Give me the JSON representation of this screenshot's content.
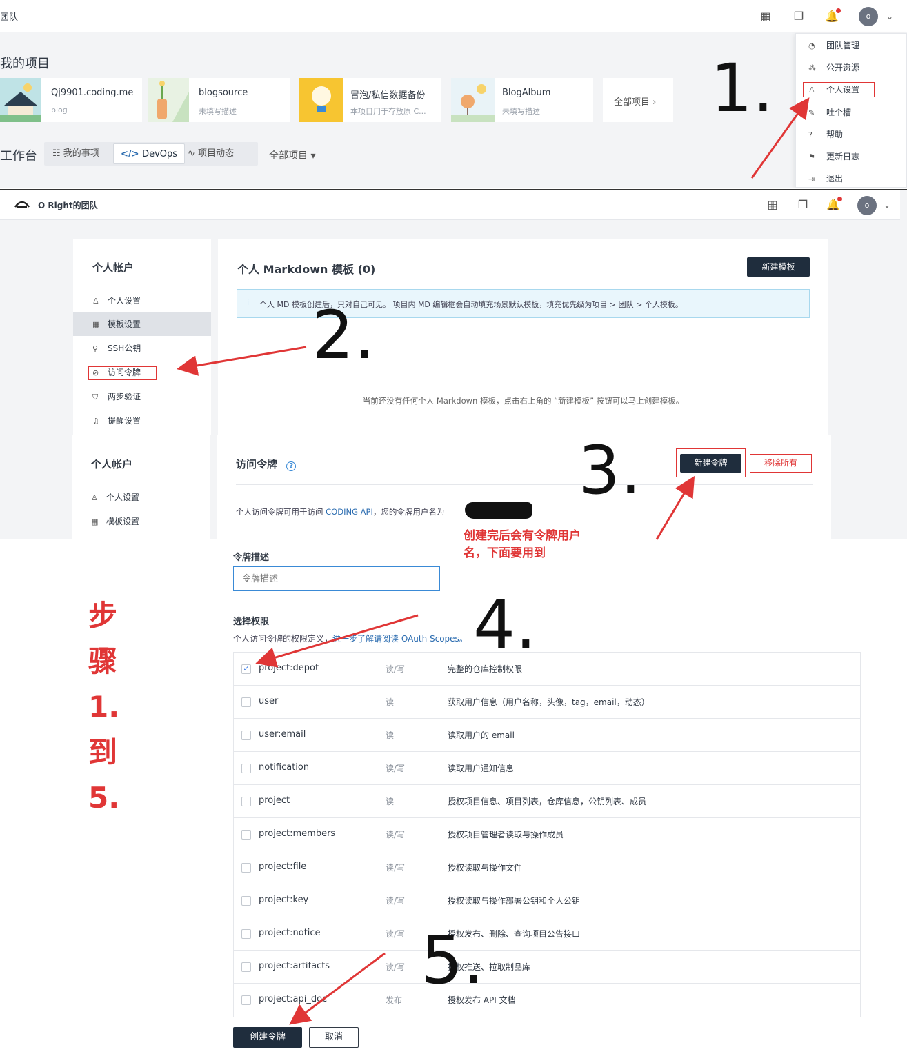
{
  "shot1": {
    "team_label": "团队",
    "my_projects_title": "我的项目",
    "projects": [
      {
        "name": "Qj9901.coding.me",
        "desc": "blog"
      },
      {
        "name": "blogsource",
        "desc": "未填写描述"
      },
      {
        "name": "冒泡/私信数据备份",
        "desc": "本项目用于存放原 C..."
      },
      {
        "name": "BlogAlbum",
        "desc": "未填写描述"
      }
    ],
    "all_projects_link": "全部项目 ›",
    "workbench_title": "工作台",
    "tabs": [
      "我的事项",
      "DevOps",
      "项目动态"
    ],
    "all_projects_dropdown": "全部项目 ▾",
    "avatar_letter": "o",
    "menu_items": [
      "团队管理",
      "公开资源",
      "个人设置",
      "吐个槽",
      "帮助",
      "更新日志",
      "退出"
    ]
  },
  "shot2": {
    "team_name": "O Right的团队",
    "avatar_letter": "o",
    "sidebar_title": "个人帐户",
    "sidebar_items": [
      "个人设置",
      "模板设置",
      "SSH公钥",
      "访问令牌",
      "两步验证",
      "提醒设置"
    ],
    "content_title": "个人 Markdown 模板 (0)",
    "new_template_button": "新建模板",
    "info_banner": "个人 MD 模板创建后，只对自己可见。 项目内 MD 编辑框会自动填充场景默认模板，填充优先级为项目 > 团队 > 个人模板。",
    "empty_message": "当前还没有任何个人 Markdown 模板，点击右上角的 “新建模板” 按钮可以马上创建模板。"
  },
  "shot3": {
    "sidebar_title": "个人帐户",
    "sidebar_items": [
      "个人设置",
      "模板设置"
    ],
    "title": "访问令牌",
    "new_token_button": "新建令牌",
    "remove_all_button": "移除所有",
    "description_prefix": "个人访问令牌可用于访问 ",
    "description_link": "CODING API",
    "description_suffix": "，您的令牌用户名为"
  },
  "shot4": {
    "token_desc_label": "令牌描述",
    "token_desc_placeholder": "令牌描述",
    "scope_label": "选择权限",
    "scope_help_prefix": "个人访问令牌的权限定义，",
    "scope_help_link": "进一步了解请阅读 OAuth Scopes。",
    "permissions": [
      {
        "name": "project:depot",
        "access": "读/写",
        "desc": "完整的仓库控制权限",
        "checked": true
      },
      {
        "name": "user",
        "access": "读",
        "desc": "获取用户信息（用户名称，头像，tag，email，动态）",
        "checked": false
      },
      {
        "name": "user:email",
        "access": "读",
        "desc": "读取用户的 email",
        "checked": false
      },
      {
        "name": "notification",
        "access": "读/写",
        "desc": "读取用户通知信息",
        "checked": false
      },
      {
        "name": "project",
        "access": "读",
        "desc": "授权项目信息、项目列表，仓库信息，公钥列表、成员",
        "checked": false
      },
      {
        "name": "project:members",
        "access": "读/写",
        "desc": "授权项目管理者读取与操作成员",
        "checked": false
      },
      {
        "name": "project:file",
        "access": "读/写",
        "desc": "授权读取与操作文件",
        "checked": false
      },
      {
        "name": "project:key",
        "access": "读/写",
        "desc": "授权读取与操作部署公钥和个人公钥",
        "checked": false
      },
      {
        "name": "project:notice",
        "access": "读/写",
        "desc": "授权发布、删除、查询项目公告接口",
        "checked": false
      },
      {
        "name": "project:artifacts",
        "access": "读/写",
        "desc": "授权推送、拉取制品库",
        "checked": false
      },
      {
        "name": "project:api_doc",
        "access": "发布",
        "desc": "授权发布 API 文档",
        "checked": false
      }
    ],
    "create_button": "创建令牌",
    "cancel_button": "取消"
  },
  "annotations": {
    "step1": "1.",
    "step2": "2.",
    "step3": "3.",
    "step4": "4.",
    "step5": "5.",
    "note": "创建完后会有令牌用户名，下面要用到",
    "note_line1": "创建完后会有令牌用户",
    "note_line2": "名，下面要用到",
    "steps_vertical": [
      "步",
      "骤",
      "1.",
      "到",
      "5."
    ]
  },
  "colors": {
    "accent_red": "#e03636",
    "dark_button": "#1f2d3d",
    "link_blue": "#2b6cb0",
    "page_gray": "#f3f4f6"
  }
}
